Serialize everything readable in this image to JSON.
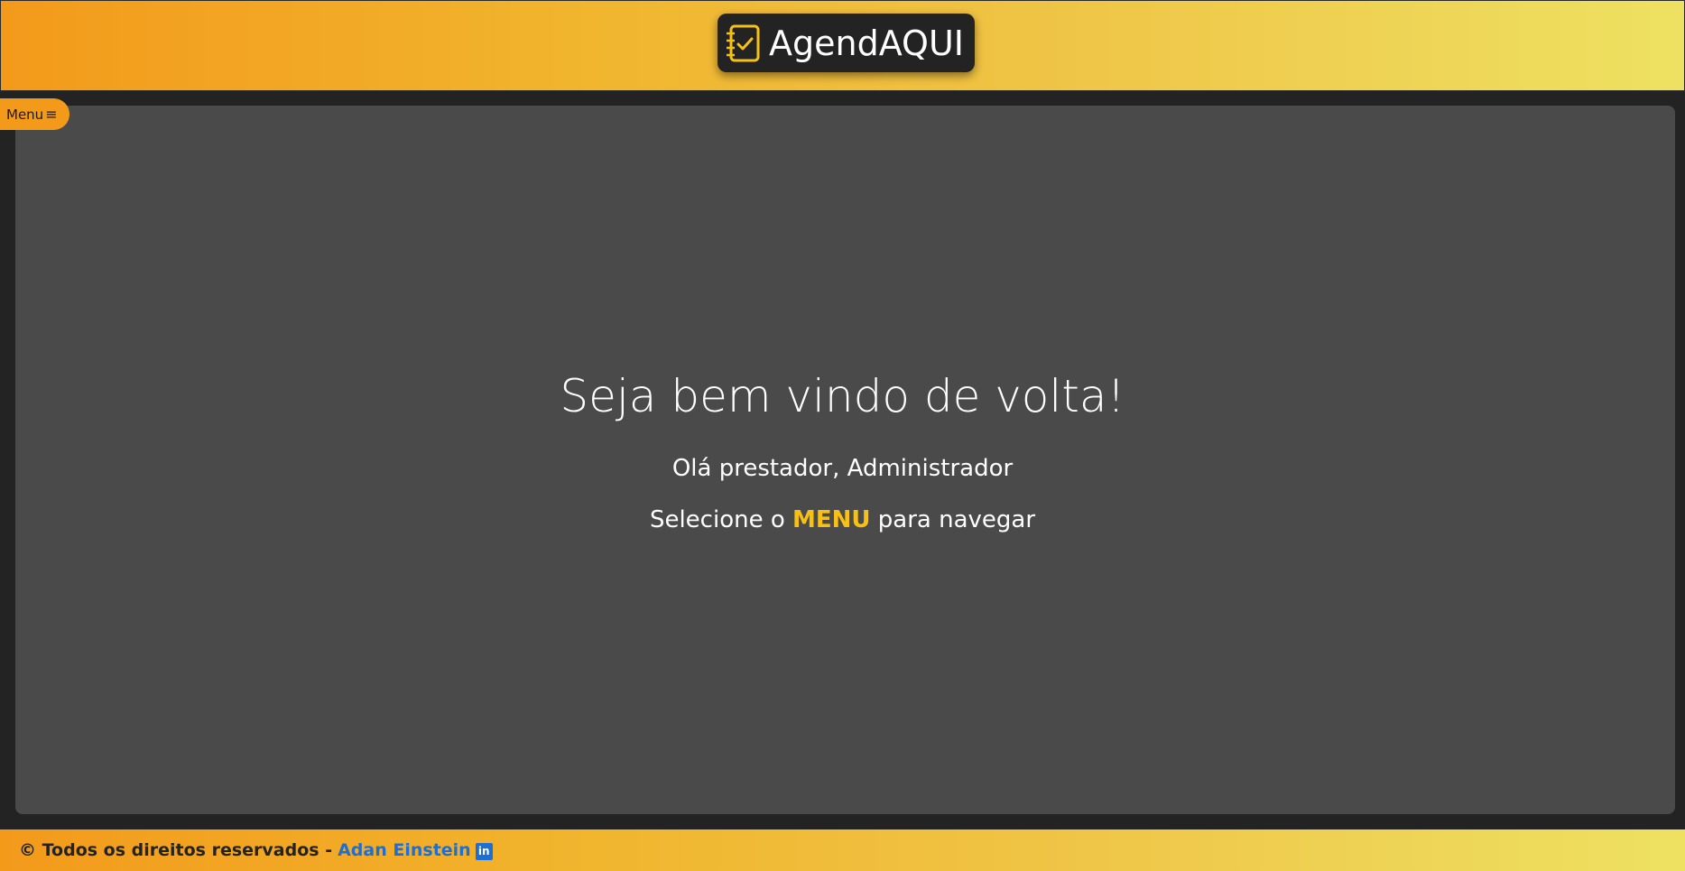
{
  "header": {
    "brand_name": "AgendAQUI",
    "brand_icon": "checklist-icon"
  },
  "menu": {
    "label": "Menu",
    "icon": "hamburger-icon",
    "icon_glyph": "≡"
  },
  "main": {
    "title": "Seja bem vindo de volta!",
    "greeting": "Olá prestador, Administrador",
    "instruction_before": "Selecione o ",
    "instruction_highlight": "MENU",
    "instruction_after": " para navegar"
  },
  "footer": {
    "copyright": "© Todos os direitos reservados -",
    "author": "Adan Einstein",
    "social_icon": "linkedin-icon",
    "social_glyph": "in"
  },
  "colors": {
    "accent_orange": "#f39a1b",
    "accent_yellow": "#eee162",
    "highlight": "#f6c015",
    "link": "#1d6fd6",
    "panel": "#4a4a4a",
    "background": "#232323"
  }
}
